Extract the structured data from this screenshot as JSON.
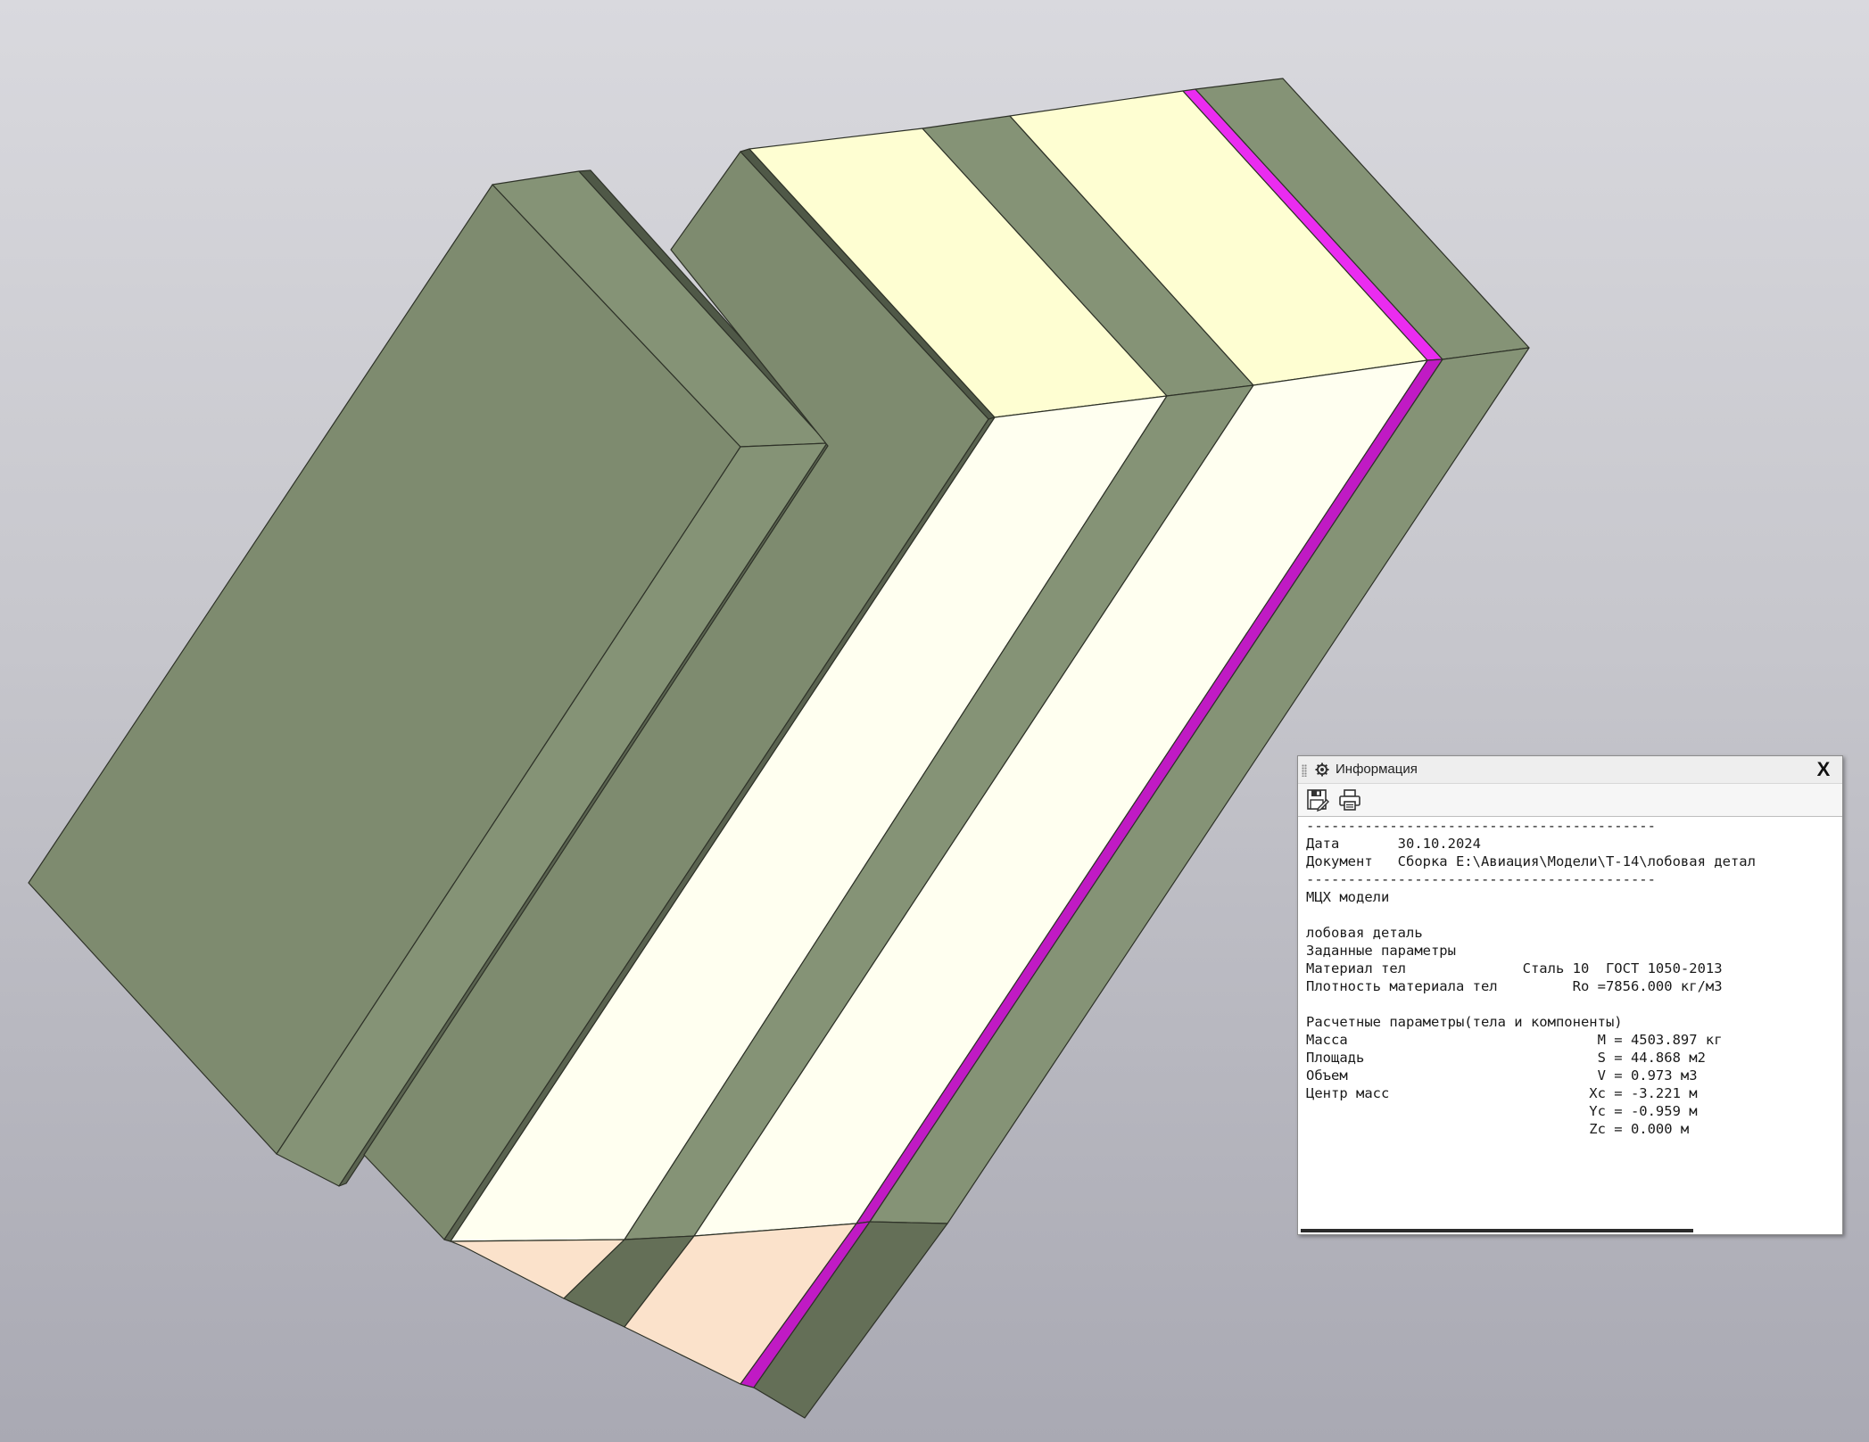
{
  "viewport": {
    "background": "#c6c6cc",
    "colors": {
      "body_dark": "#7e8b6f",
      "body_mid": "#859376",
      "body_shadow": "#646f57",
      "section_top": "#fefed2",
      "section_front": "#fffff0",
      "section_bottom": "#fbe2cb",
      "edge_magenta": "#ea2cf0",
      "edge_magenta_dark": "#c01ac4",
      "outline": "#2e3228"
    }
  },
  "info_panel": {
    "title": "Информация",
    "title_icon": "gear-icon",
    "close_label": "X",
    "toolbar": {
      "save_icon": "save-icon",
      "print_icon": "print-icon"
    },
    "lines": [
      "------------------------------------------",
      "Дата       30.10.2024",
      "Документ   Сборка E:\\Авиация\\Модели\\T-14\\лобовая детал",
      "------------------------------------------",
      "МЦХ модели",
      "",
      "лобовая деталь",
      "Заданные параметры",
      "Материал тел              Сталь 10  ГОСТ 1050-2013",
      "Плотность материала тел         Ro =7856.000 кг/м3",
      "",
      "Расчетные параметры(тела и компоненты)",
      "Масса                              M = 4503.897 кг",
      "Площадь                            S = 44.868 м2",
      "Объем                              V = 0.973 м3",
      "Центр масс                        Xc = -3.221 м",
      "                                  Yc = -0.959 м",
      "                                  Zc = 0.000 м"
    ]
  }
}
